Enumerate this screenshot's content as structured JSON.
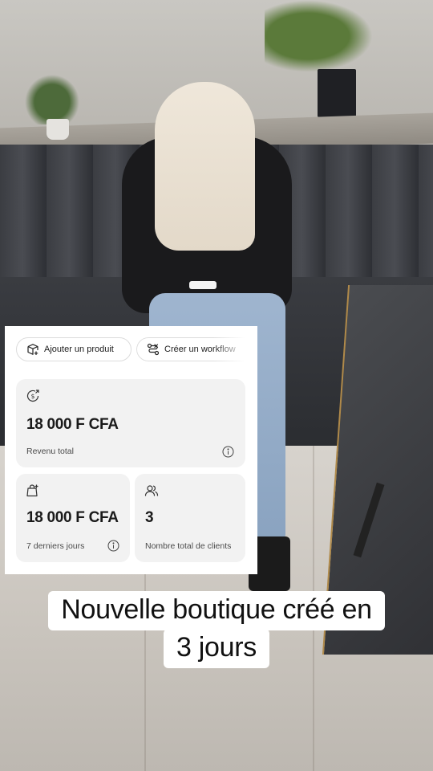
{
  "actions": {
    "add_product": "Ajouter un produit",
    "create_workflow": "Créer un workflow"
  },
  "stats": {
    "total_revenue": {
      "value": "18 000 F CFA",
      "label": "Revenu total"
    },
    "last_7_days": {
      "value": "18 000 F CFA",
      "label": "7 derniers jours"
    },
    "total_customers": {
      "value": "3",
      "label": "Nombre total de clients"
    }
  },
  "caption": {
    "line1": "Nouvelle boutique créé en",
    "line2": "3 jours"
  },
  "icons": {
    "add_product": "box-plus-icon",
    "create_workflow": "workflow-icon",
    "revenue": "dollar-circle-icon",
    "week": "shopping-bag-icon",
    "customers": "users-icon",
    "info": "info-icon"
  }
}
